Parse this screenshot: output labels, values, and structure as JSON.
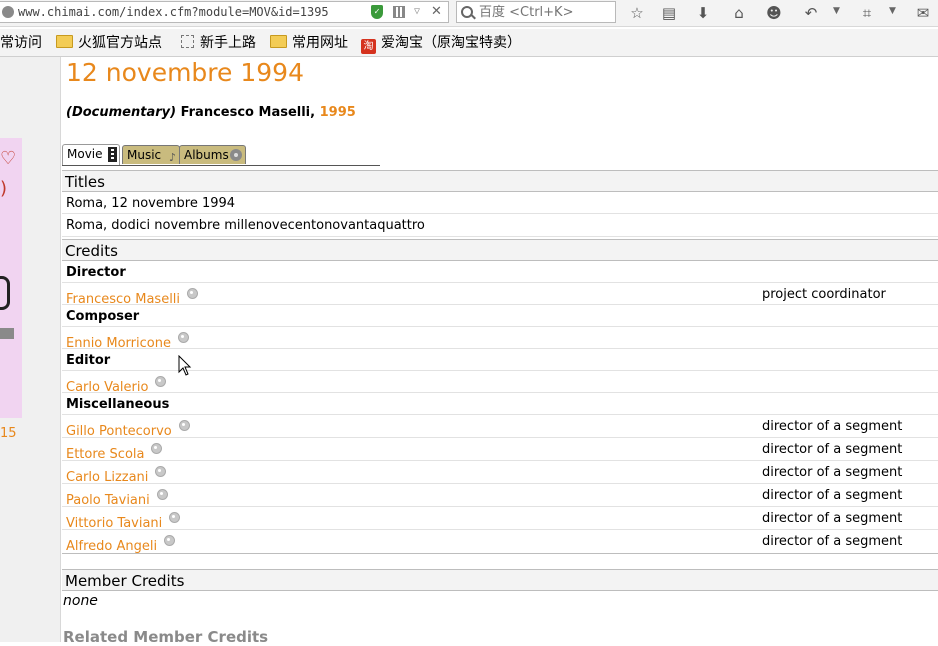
{
  "browser": {
    "url": "www.chimai.com/index.cfm?module=MOV&id=1395",
    "search_placeholder": "百度 <Ctrl+K>",
    "bookmarks": [
      "常访问",
      "火狐官方站点",
      "新手上路",
      "常用网址",
      "爱淘宝（原淘宝特卖）"
    ],
    "taobao_glyph": "淘"
  },
  "sidebar": {
    "year_fragment": "15"
  },
  "page": {
    "title": "12 novembre 1994",
    "genre": "(Documentary)",
    "director_name": "Francesco Maselli,",
    "year": "1995",
    "tabs": [
      "Movie",
      "Music",
      "Albums"
    ]
  },
  "titles": {
    "heading": "Titles",
    "items": [
      "Roma, 12 novembre 1994",
      "Roma, dodici novembre millenovecentonovantaquattro"
    ]
  },
  "credits": {
    "heading": "Credits",
    "groups": {
      "director": "Director",
      "composer": "Composer",
      "editor": "Editor",
      "misc": "Miscellaneous"
    },
    "people": [
      {
        "name": "Francesco Maselli",
        "role": "project coordinator"
      },
      {
        "name": "Ennio Morricone",
        "role": ""
      },
      {
        "name": "Carlo Valerio",
        "role": ""
      },
      {
        "name": "Gillo Pontecorvo",
        "role": "director of a segment"
      },
      {
        "name": "Ettore Scola",
        "role": "director of a segment"
      },
      {
        "name": "Carlo Lizzani",
        "role": "director of a segment"
      },
      {
        "name": "Paolo Taviani",
        "role": "director of a segment"
      },
      {
        "name": "Vittorio Taviani",
        "role": "director of a segment"
      },
      {
        "name": "Alfredo Angeli",
        "role": "director of a segment"
      }
    ]
  },
  "member_credits": {
    "heading": "Member Credits",
    "value": "none"
  },
  "related_member_credits": {
    "heading": "Related Member Credits"
  },
  "colors": {
    "accent": "#e8881c",
    "tab_inactive": "#c9bb7e"
  }
}
